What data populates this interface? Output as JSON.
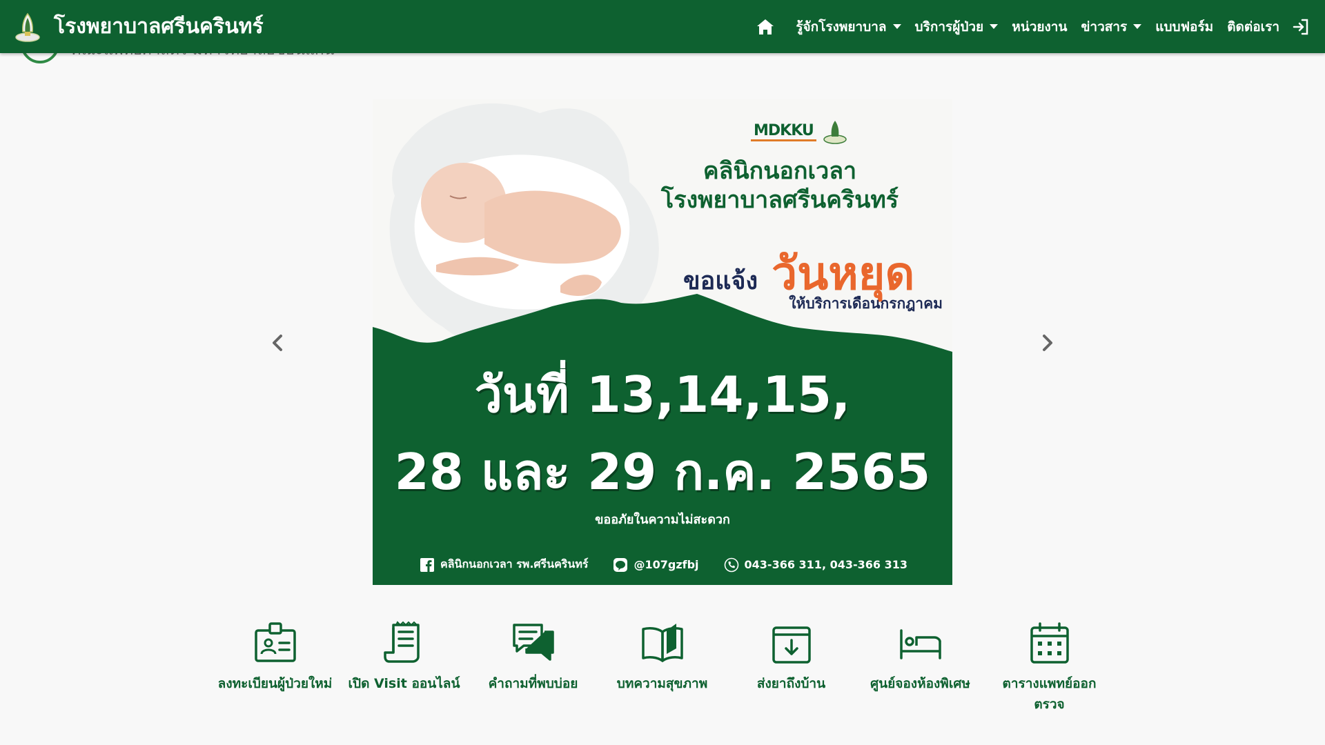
{
  "navbar": {
    "brand_title": "โรงพยาบาลศรีนครินทร์",
    "items": [
      {
        "label": "รู้จักโรงพยาบาล",
        "dropdown": true
      },
      {
        "label": "บริการผู้ป่วย",
        "dropdown": true
      },
      {
        "label": "หน่วยงาน",
        "dropdown": false
      },
      {
        "label": "ข่าวสาร",
        "dropdown": true
      },
      {
        "label": "แบบฟอร์ม",
        "dropdown": false
      },
      {
        "label": "ติดต่อเรา",
        "dropdown": false
      }
    ],
    "icons": {
      "home": "home-icon",
      "login": "login-icon"
    }
  },
  "subheader": {
    "text": "คณะแพทยศาสตร์ มหาวิทยาลัยขอนแก่น"
  },
  "banner": {
    "logo_text": "MDKKU",
    "line1": "คลินิกนอกเวลา",
    "line2": "โรงพยาบาลศรีนครินทร์",
    "notify_small": "ขอแจ้ง",
    "notify_big": "วันหยุด",
    "service_month": "ให้บริการเดือนกรกฎาคม",
    "dates_line1": "วันที่ 13,14,15,",
    "dates_line2": "28 และ 29 ก.ค. 2565",
    "apology": "ขออภัยในความไม่สะดวก",
    "footer": {
      "facebook": "คลินิกนอกเวลา รพ.ศรีนครินทร์",
      "line": "@107gzfbj",
      "phone": "043-366 311, 043-366 313"
    }
  },
  "quick_links": [
    {
      "label": "ลงทะเบียนผู้ป่วยใหม่",
      "icon": "id-card-icon"
    },
    {
      "label": "เปิด Visit ออนไลน์",
      "icon": "receipt-icon"
    },
    {
      "label": "คำถามที่พบบ่อย",
      "icon": "chat-icon"
    },
    {
      "label": "บทความสุขภาพ",
      "icon": "book-icon"
    },
    {
      "label": "ส่งยาถึงบ้าน",
      "icon": "delivery-box-icon"
    },
    {
      "label": "ศูนย์จองห้องพิเศษ",
      "icon": "bed-icon"
    },
    {
      "label": "ตารางแพทย์ออกตรวจ",
      "icon": "calendar-icon"
    }
  ],
  "colors": {
    "brand_green": "#0e6130",
    "accent_orange": "#e9672d",
    "navy": "#1d2a55"
  }
}
